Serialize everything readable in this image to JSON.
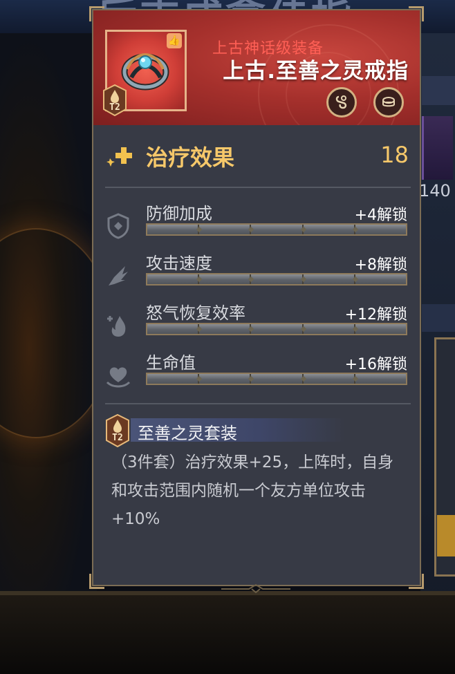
{
  "background": {
    "title_partial": "后吉成拿佳指",
    "right_number": "140"
  },
  "item": {
    "rarity": "上古神话级装备",
    "name": "上古.至善之灵戒指",
    "tier": "T2",
    "header_buttons": [
      "lock-icon",
      "coins-icon"
    ]
  },
  "main_stat": {
    "label": "治疗效果",
    "value": "18",
    "icon": "sparkle-plus-icon"
  },
  "sub_stats": [
    {
      "label": "防御加成",
      "unlock": "+4解锁",
      "icon": "shield-icon",
      "progress": 0
    },
    {
      "label": "攻击速度",
      "unlock": "+8解锁",
      "icon": "wing-icon",
      "progress": 0
    },
    {
      "label": "怒气恢复效率",
      "unlock": "+12解锁",
      "icon": "flame-icon",
      "progress": 0
    },
    {
      "label": "生命值",
      "unlock": "+16解锁",
      "icon": "heart-icon",
      "progress": 0
    }
  ],
  "set": {
    "tier": "T2",
    "name": "至善之灵套装",
    "description": "（3件套）治疗效果+25，上阵时，自身和攻击范围内随机一个友方单位攻击+10%"
  },
  "colors": {
    "panel_bg": "#373a45",
    "header_red": "#a5302c",
    "gold_text": "#f6c86a",
    "rarity_red": "#ff5f55"
  }
}
